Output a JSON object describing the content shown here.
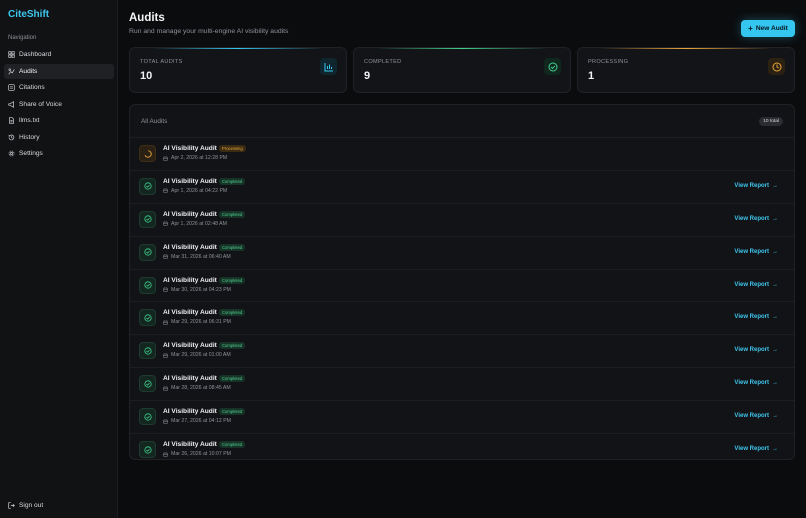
{
  "brand": "CiteShift",
  "sidebar": {
    "heading": "Navigation",
    "items": [
      {
        "label": "Dashboard",
        "icon": "dashboard-icon"
      },
      {
        "label": "Audits",
        "icon": "audits-icon"
      },
      {
        "label": "Citations",
        "icon": "citations-icon"
      },
      {
        "label": "Share of Voice",
        "icon": "megaphone-icon"
      },
      {
        "label": "llms.txt",
        "icon": "file-icon"
      },
      {
        "label": "History",
        "icon": "history-icon"
      },
      {
        "label": "Settings",
        "icon": "gear-icon"
      }
    ],
    "active_index": 1,
    "signout": "Sign out"
  },
  "header": {
    "title": "Audits",
    "subtitle": "Run and manage your multi-engine AI visibility audits",
    "new_button": "New Audit"
  },
  "stats": [
    {
      "label": "TOTAL AUDITS",
      "value": "10",
      "icon": "bar-chart-icon",
      "accent": "#35c6ef"
    },
    {
      "label": "COMPLETED",
      "value": "9",
      "icon": "check-circle-icon",
      "accent": "#3fd08e"
    },
    {
      "label": "PROCESSING",
      "value": "1",
      "icon": "clock-icon",
      "accent": "#e9a53a"
    }
  ],
  "audits": {
    "title": "All Audits",
    "count": "10 total",
    "view_label": "View Report",
    "rows": [
      {
        "name": "AI Visibility Audit",
        "status": "Processing",
        "date": "Apr 2, 2026 at 12:28 PM"
      },
      {
        "name": "AI Visibility Audit",
        "status": "Completed",
        "date": "Apr 1, 2026 at 04:22 PM"
      },
      {
        "name": "AI Visibility Audit",
        "status": "Completed",
        "date": "Apr 1, 2026 at 02:48 AM"
      },
      {
        "name": "AI Visibility Audit",
        "status": "Completed",
        "date": "Mar 31, 2026 at 06:40 AM"
      },
      {
        "name": "AI Visibility Audit",
        "status": "Completed",
        "date": "Mar 30, 2026 at 04:23 PM"
      },
      {
        "name": "AI Visibility Audit",
        "status": "Completed",
        "date": "Mar 29, 2026 at 06:31 PM"
      },
      {
        "name": "AI Visibility Audit",
        "status": "Completed",
        "date": "Mar 29, 2026 at 01:00 AM"
      },
      {
        "name": "AI Visibility Audit",
        "status": "Completed",
        "date": "Mar 28, 2026 at 08:45 AM"
      },
      {
        "name": "AI Visibility Audit",
        "status": "Completed",
        "date": "Mar 27, 2026 at 04:12 PM"
      },
      {
        "name": "AI Visibility Audit",
        "status": "Completed",
        "date": "Mar 26, 2026 at 10:07 PM"
      }
    ]
  },
  "colors": {
    "accent": "#35c6ef",
    "completed": "#3fd08e",
    "processing": "#e9a53a",
    "background": "#0b0c0e"
  }
}
